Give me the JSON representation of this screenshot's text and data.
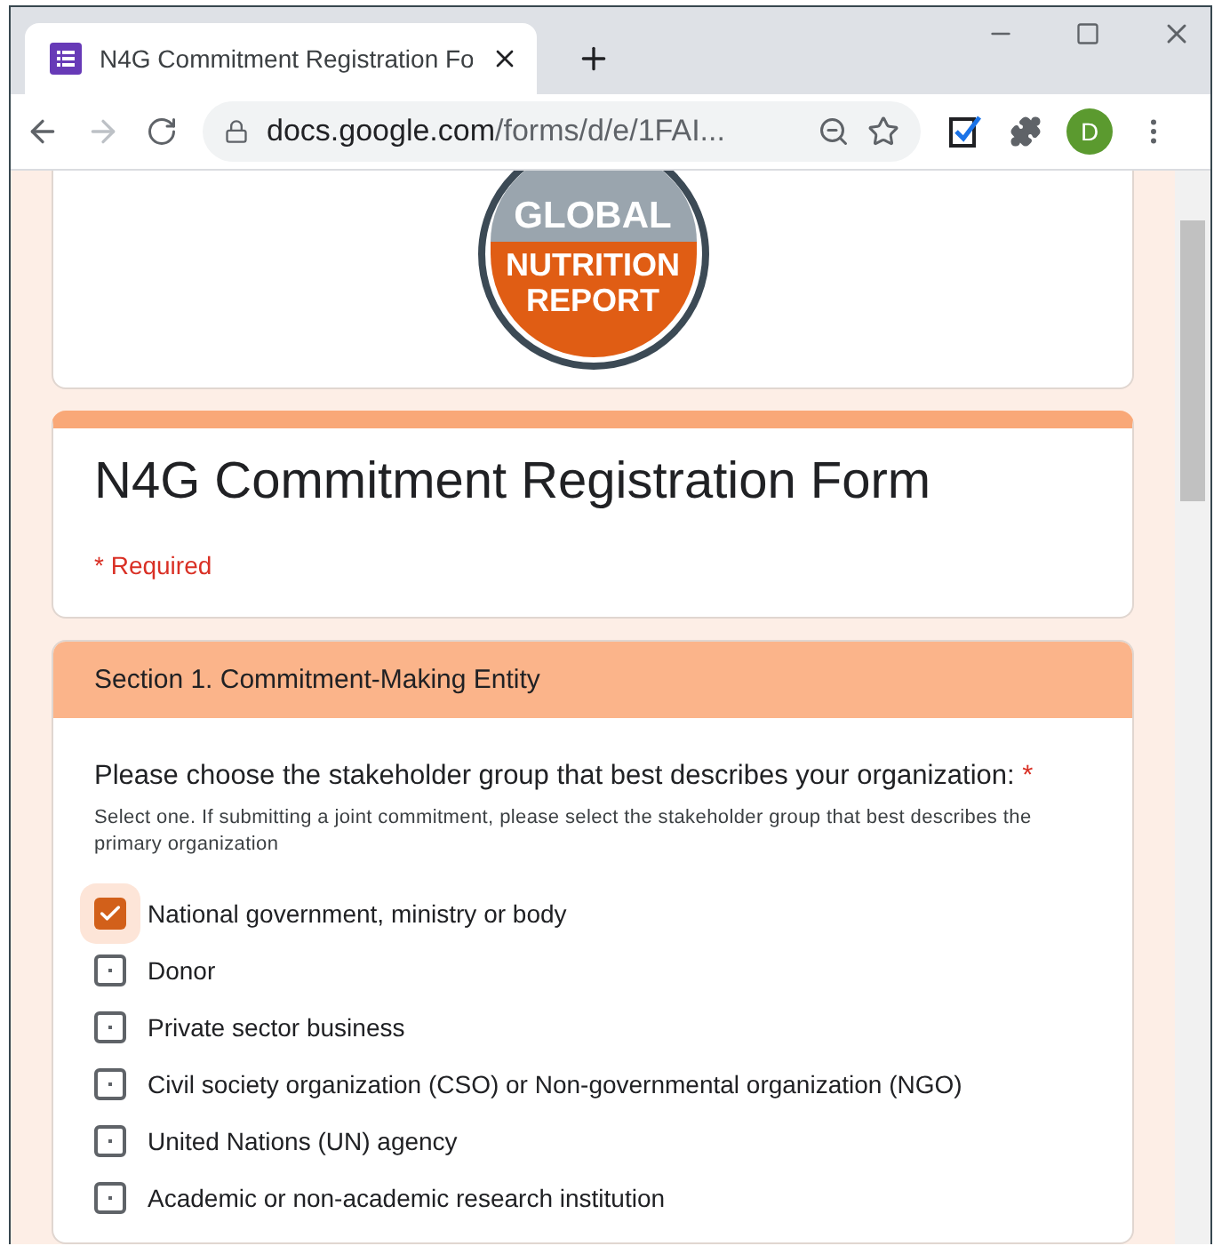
{
  "browser": {
    "tab_title": "N4G Commitment Registration Fo",
    "avatar_letter": "D",
    "address_host": "docs.google.com",
    "address_path": "/forms/d/e/1FAI..."
  },
  "logo": {
    "lines": [
      "GLOBAL",
      "NUTRITION",
      "REPORT"
    ]
  },
  "form": {
    "title": "N4G Commitment Registration Form",
    "required_note": "* Required"
  },
  "section": {
    "title": "Section 1. Commitment-Making Entity",
    "question": {
      "text": "Please choose the stakeholder group that best describes your organization:",
      "required_mark": "*",
      "help": "Select one. If submitting a joint commitment, please select the stakeholder group that best describes the primary organization",
      "options": [
        {
          "label": "National government, ministry or body",
          "checked": true
        },
        {
          "label": "Donor",
          "checked": false
        },
        {
          "label": "Private sector business",
          "checked": false
        },
        {
          "label": "Civil society organization (CSO) or Non-governmental organization (NGO)",
          "checked": false
        },
        {
          "label": "United Nations (UN) agency",
          "checked": false
        },
        {
          "label": "Academic or non-academic research institution",
          "checked": false
        }
      ]
    }
  }
}
